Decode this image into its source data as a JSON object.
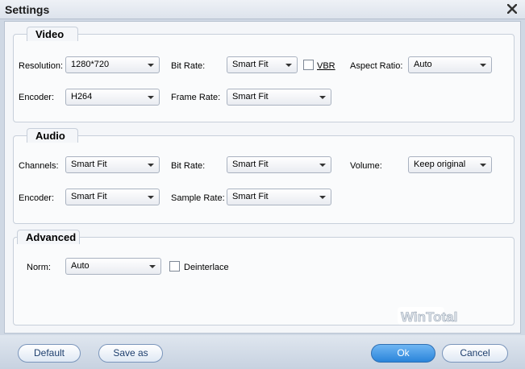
{
  "window": {
    "title": "Settings"
  },
  "video": {
    "legend": "Video",
    "resolution_label": "Resolution:",
    "resolution_value": "1280*720",
    "bitrate_label": "Bit Rate:",
    "bitrate_value": "Smart Fit",
    "vbr_label": "VBR",
    "aspect_label": "Aspect Ratio:",
    "aspect_value": "Auto",
    "encoder_label": "Encoder:",
    "encoder_value": "H264",
    "framerate_label": "Frame Rate:",
    "framerate_value": "Smart Fit"
  },
  "audio": {
    "legend": "Audio",
    "channels_label": "Channels:",
    "channels_value": "Smart Fit",
    "bitrate_label": "Bit Rate:",
    "bitrate_value": "Smart Fit",
    "volume_label": "Volume:",
    "volume_value": "Keep original",
    "encoder_label": "Encoder:",
    "encoder_value": "Smart Fit",
    "samplerate_label": "Sample Rate:",
    "samplerate_value": "Smart Fit"
  },
  "advanced": {
    "legend": "Advanced",
    "norm_label": "Norm:",
    "norm_value": "Auto",
    "deinterlace_label": "Deinterlace"
  },
  "footer": {
    "default_label": "Default",
    "saveas_label": "Save as",
    "ok_label": "Ok",
    "cancel_label": "Cancel"
  },
  "watermark_text": "WinTotal"
}
